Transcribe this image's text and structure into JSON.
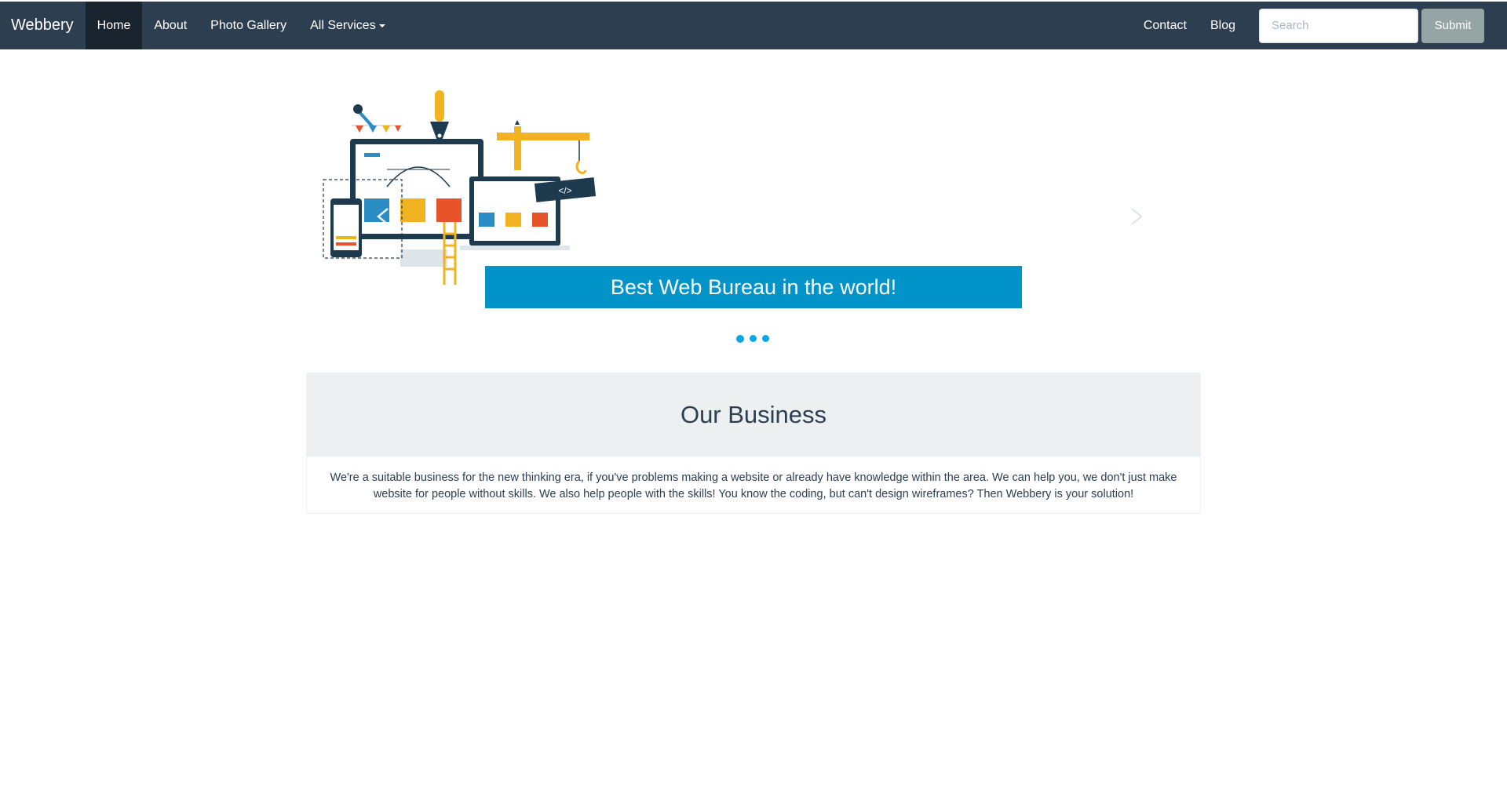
{
  "navbar": {
    "brand": "Webbery",
    "left_links": [
      {
        "label": "Home",
        "active": true
      },
      {
        "label": "About"
      },
      {
        "label": "Photo Gallery"
      },
      {
        "label": "All Services",
        "dropdown": true
      }
    ],
    "right_links": [
      {
        "label": "Contact"
      },
      {
        "label": "Blog"
      }
    ],
    "search_placeholder": "Search",
    "submit_label": "Submit"
  },
  "carousel": {
    "caption": "Best Web Bureau in the world!",
    "slide_count": 3,
    "active_slide": 1,
    "illustration_icon": "web-design-illustration-icon",
    "code_tag": "</>"
  },
  "section": {
    "title": "Our Business",
    "body": "We're a suitable business for the new thinking era, if you've problems making a website or already have knowledge within the area. We can help you, we don't just make website for people without skills. We also help people with the skills! You know the coding, but can't design wireframes? Then Webbery is your solution!"
  },
  "colors": {
    "navbar": "#2c3e50",
    "navbar_active": "#1a242f",
    "caption_bg": "#0293c8",
    "indicator": "#0aa5e6",
    "panel_heading": "#ecf0f1",
    "submit_bg": "#95a5a6"
  }
}
